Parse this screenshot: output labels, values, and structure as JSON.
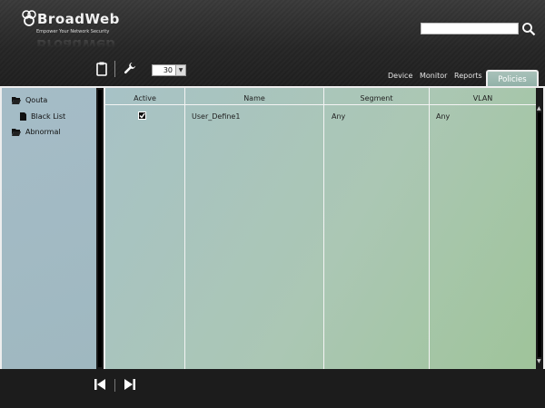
{
  "app": {
    "brand": "BroadWeb",
    "tagline": "Empower Your Network Security"
  },
  "search": {
    "value": "",
    "placeholder": ""
  },
  "toolbar": {
    "page_size": "30"
  },
  "tabs": [
    {
      "label": "Device"
    },
    {
      "label": "Monitor"
    },
    {
      "label": "Reports"
    },
    {
      "label": "Policies",
      "active": true
    }
  ],
  "sidebar": {
    "items": [
      {
        "label": "Qouta",
        "icon": "folder-open-icon"
      },
      {
        "label": "Black List",
        "icon": "file-icon"
      },
      {
        "label": "Abnormal",
        "icon": "folder-open-icon"
      }
    ]
  },
  "table": {
    "columns": [
      "Active",
      "Name",
      "Segment",
      "VLAN"
    ],
    "rows": [
      {
        "active": true,
        "name": "User_Define1",
        "segment": "Any",
        "vlan": "Any"
      }
    ]
  },
  "colors": {
    "accent": "#9fb9b1",
    "background": "#1c1c1c"
  }
}
